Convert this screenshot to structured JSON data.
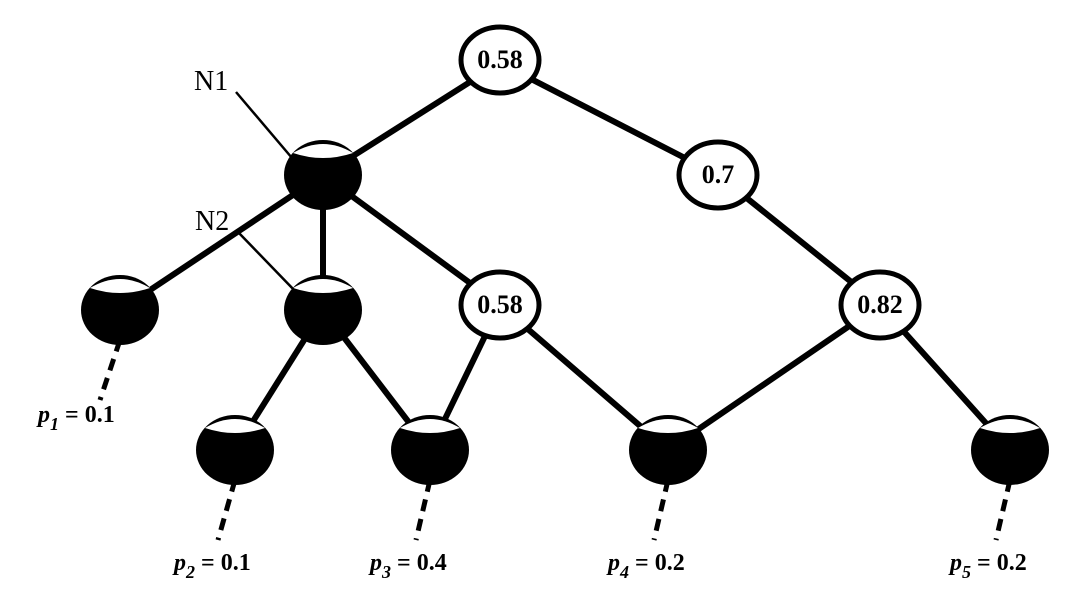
{
  "diagram": {
    "named_labels": {
      "N1": "N1",
      "N2": "N2"
    },
    "white_nodes": {
      "root": {
        "value": "0.58"
      },
      "right": {
        "value": "0.7"
      },
      "mid": {
        "value": "0.58"
      },
      "far": {
        "value": "0.82"
      }
    },
    "leaves": {
      "p1": {
        "sym": "p",
        "idx": "1",
        "val": "0.1"
      },
      "p2": {
        "sym": "p",
        "idx": "2",
        "val": "0.1"
      },
      "p3": {
        "sym": "p",
        "idx": "3",
        "val": "0.4"
      },
      "p4": {
        "sym": "p",
        "idx": "4",
        "val": "0.2"
      },
      "p5": {
        "sym": "p",
        "idx": "5",
        "val": "0.2"
      }
    }
  }
}
